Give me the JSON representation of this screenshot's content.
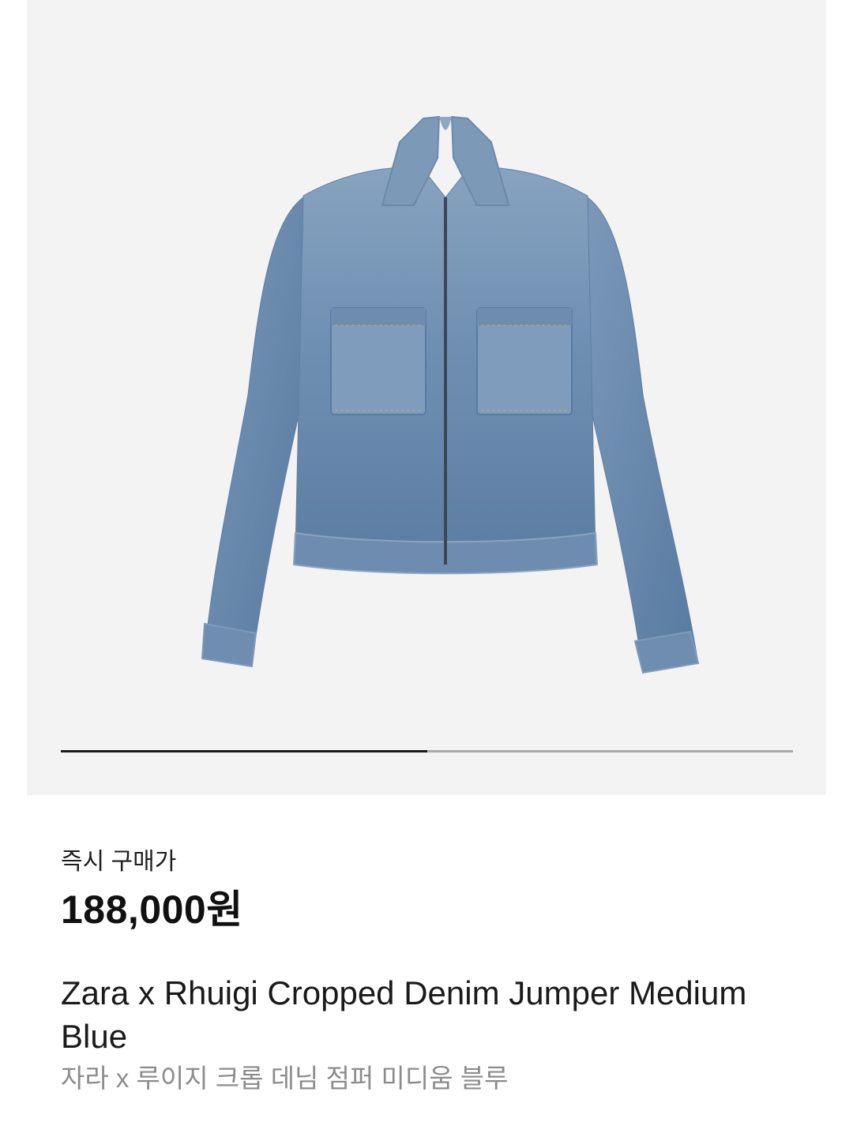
{
  "product": {
    "image_icon": "denim-jacket-image",
    "image_alt": "Zara x Rhuigi Cropped Denim Jumper Medium Blue",
    "gallery_progress": 0.5,
    "colors": {
      "hero_background": "#f3f3f3",
      "denim": "#6f8fb1",
      "progress_active": "#1a1a1a",
      "progress_track": "#a9a9a9"
    }
  },
  "pricing": {
    "label": "즉시 구매가",
    "price": "188,000원"
  },
  "title": {
    "english": "Zara x Rhuigi Cropped Denim Jumper Medium Blue",
    "korean": "자라 x 루이지 크롭 데님 점퍼 미디움 블루"
  }
}
